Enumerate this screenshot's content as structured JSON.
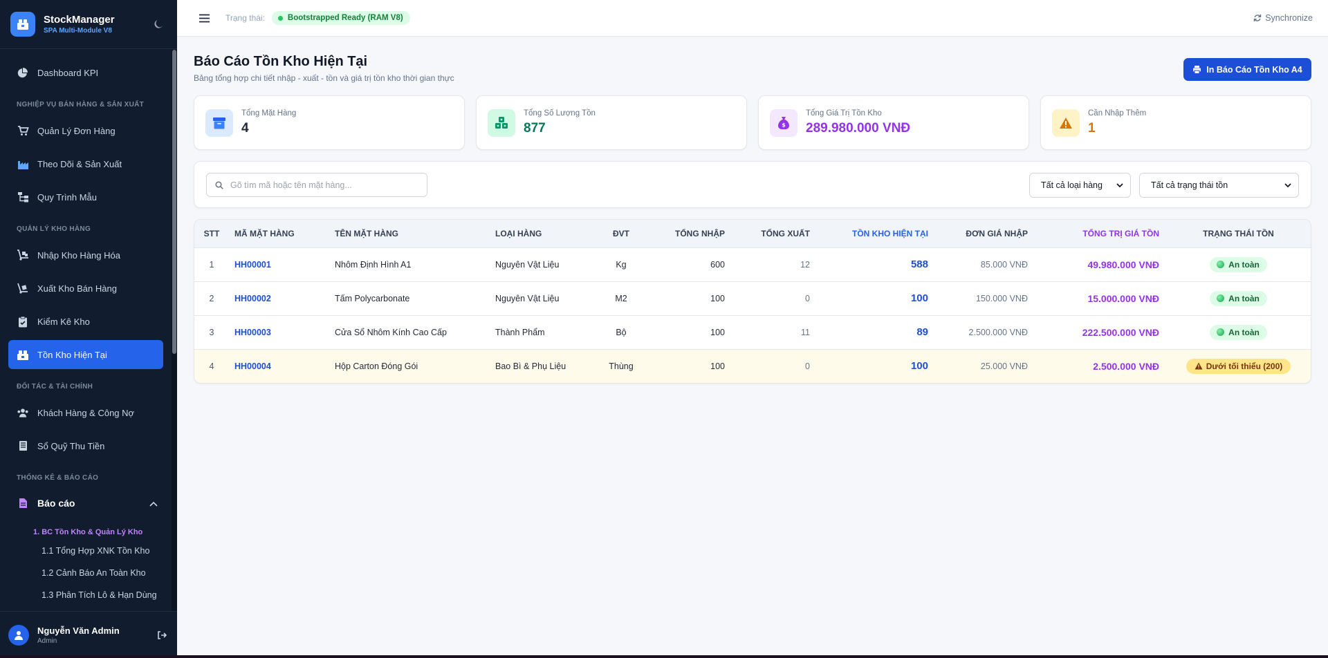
{
  "app": {
    "name": "StockManager",
    "subtitle": "SPA Multi-Module V8"
  },
  "sidebar": {
    "dashboard": "Dashboard KPI",
    "section_sales": "NGHIỆP VỤ BÁN HÀNG & SẢN XUẤT",
    "orders": "Quản Lý Đơn Hàng",
    "production": "Theo Dõi & Sản Xuất",
    "process": "Quy Trình Mẫu",
    "section_warehouse": "QUẢN LÝ KHO HÀNG",
    "import": "Nhập Kho Hàng Hóa",
    "export": "Xuất Kho Bán Hàng",
    "stocktake": "Kiểm Kê Kho",
    "current_stock": "Tồn Kho Hiện Tại",
    "section_partners": "ĐỐI TÁC & TÀI CHÍNH",
    "customers": "Khách Hàng & Công Nợ",
    "cashbook": "Sổ Quỹ Thu Tiền",
    "section_reports": "THỐNG KÊ & BÁO CÁO",
    "reports": "Báo cáo",
    "report_group": "1. BC Tồn Kho & Quản Lý Kho",
    "report_items": [
      "1.1 Tổng Hợp XNK Tồn Kho",
      "1.2 Cảnh Báo An Toàn Kho",
      "1.3 Phân Tích Lô & Hạn Dùng"
    ]
  },
  "user": {
    "name": "Nguyễn Văn Admin",
    "role": "Admin"
  },
  "topbar": {
    "status_label": "Trạng thái:",
    "status_value": "Bootstrapped Ready (RAM V8)",
    "sync": "Synchronize"
  },
  "page": {
    "title": "Báo Cáo Tồn Kho Hiện Tại",
    "subtitle": "Bảng tổng hợp chi tiết nhập - xuất - tồn và giá trị tồn kho thời gian thực",
    "print_button": "In Báo Cáo Tồn Kho A4"
  },
  "stats": [
    {
      "label": "Tổng Mặt Hàng",
      "value": "4",
      "color": "#1f2937",
      "icon": "box-icon"
    },
    {
      "label": "Tổng Số Lượng Tồn",
      "value": "877",
      "color": "#047857",
      "icon": "cubes-icon"
    },
    {
      "label": "Tổng Giá Trị Tồn Kho",
      "value": "289.980.000 VNĐ",
      "color": "#9333ea",
      "icon": "money-bag-icon"
    },
    {
      "label": "Cần Nhập Thêm",
      "value": "1",
      "color": "#d97706",
      "icon": "warning-icon"
    }
  ],
  "filters": {
    "search_placeholder": "Gõ tìm mã hoặc tên mặt hàng...",
    "category_selected": "Tất cả loại hàng",
    "status_selected": "Tất cả trạng thái tồn"
  },
  "table": {
    "headers": {
      "stt": "STT",
      "code": "MÃ MẶT HÀNG",
      "name": "TÊN MẶT HÀNG",
      "category": "LOẠI HÀNG",
      "unit": "ĐVT",
      "total_in": "TỔNG NHẬP",
      "total_out": "TỔNG XUẤT",
      "stock": "TỒN KHO HIỆN TẠI",
      "unit_price": "ĐƠN GIÁ NHẬP",
      "total_value": "TỔNG TRỊ GIÁ TỒN",
      "status": "TRẠNG THÁI TỒN"
    },
    "rows": [
      {
        "stt": "1",
        "code": "HH00001",
        "name": "Nhôm Định Hình A1",
        "category": "Nguyên Vật Liệu",
        "unit": "Kg",
        "total_in": "600",
        "total_out": "12",
        "stock": "588",
        "unit_price": "85.000 VNĐ",
        "total_value": "49.980.000 VNĐ",
        "status": "An toàn"
      },
      {
        "stt": "2",
        "code": "HH00002",
        "name": "Tấm Polycarbonate",
        "category": "Nguyên Vật Liệu",
        "unit": "M2",
        "total_in": "100",
        "total_out": "0",
        "stock": "100",
        "unit_price": "150.000 VNĐ",
        "total_value": "15.000.000 VNĐ",
        "status": "An toàn"
      },
      {
        "stt": "3",
        "code": "HH00003",
        "name": "Cửa Sổ Nhôm Kính Cao Cấp",
        "category": "Thành Phẩm",
        "unit": "Bộ",
        "total_in": "100",
        "total_out": "11",
        "stock": "89",
        "unit_price": "2.500.000 VNĐ",
        "total_value": "222.500.000 VNĐ",
        "status": "An toàn"
      },
      {
        "stt": "4",
        "code": "HH00004",
        "name": "Hộp Carton Đóng Gói",
        "category": "Bao Bì & Phụ Liệu",
        "unit": "Thùng",
        "total_in": "100",
        "total_out": "0",
        "stock": "100",
        "unit_price": "25.000 VNĐ",
        "total_value": "2.500.000 VNĐ",
        "status": "Dưới tối thiểu (200)"
      }
    ]
  }
}
